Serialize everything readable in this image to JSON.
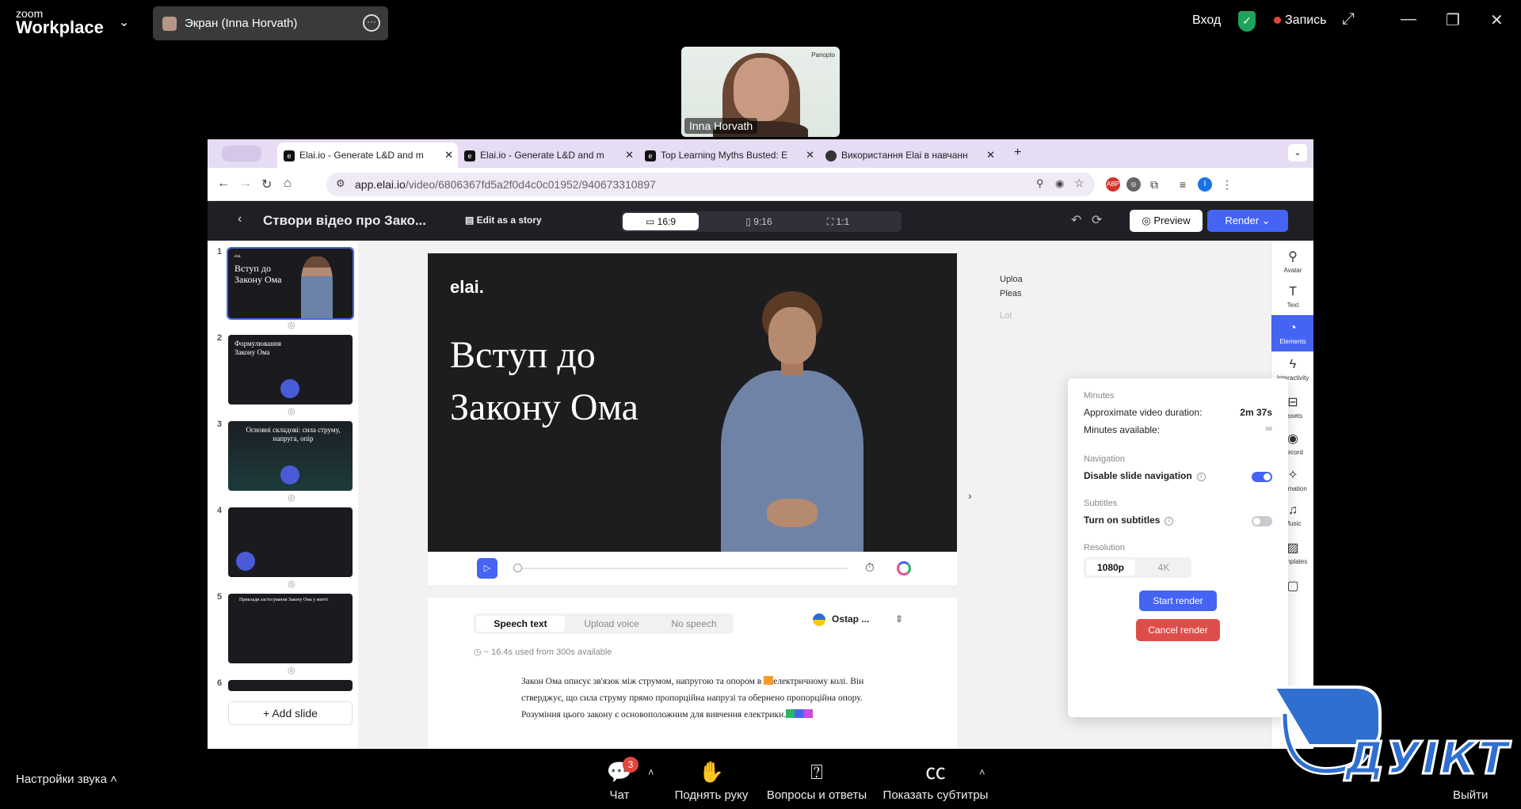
{
  "zoom": {
    "brand_small": "zoom",
    "brand_big": "Workplace",
    "share_label": "Экран (Inna Horvath)",
    "signin": "Вход",
    "record": "Запись",
    "participant_name": "Inna Horvath",
    "participant_brand": "Panopto",
    "bottom": {
      "audio_settings": "Настройки звука",
      "chat": "Чат",
      "chat_badge": "3",
      "raise_hand": "Поднять руку",
      "qa": "Вопросы и ответы",
      "captions": "Показать субтитры",
      "leave": "Выйти"
    }
  },
  "browser": {
    "tabs": [
      {
        "title": "Elai.io - Generate L&D and m",
        "active": true
      },
      {
        "title": "Elai.io - Generate L&D and m",
        "active": false
      },
      {
        "title": "Top Learning Myths Busted: E",
        "active": false
      },
      {
        "title": "Використання Elai в навчанн",
        "active": false
      }
    ],
    "url_host": "app.elai.io",
    "url_path": "/video/6806367fd5a2f0d4c0c01952/940673310897",
    "ext_abp": "ABP",
    "profile_initial": "I"
  },
  "elai": {
    "project_title": "Створи відео про Зако...",
    "edit_story": "Edit as a story",
    "ratios": [
      "16:9",
      "9:16",
      "1:1"
    ],
    "preview": "Preview",
    "render": "Render",
    "slides": [
      {
        "num": "1",
        "title": "Вступ до Закону Ома"
      },
      {
        "num": "2",
        "title": "Формулювання Закону Ома"
      },
      {
        "num": "3",
        "title": "Основні складові: сила струму, напруга, опір"
      },
      {
        "num": "4",
        "title": ""
      },
      {
        "num": "5",
        "title": "Приклади застосування Закону Ома у житті"
      },
      {
        "num": "6",
        "title": ""
      }
    ],
    "add_slide": "Add slide",
    "canvas": {
      "logo": "elai.",
      "title": "Вступ до Закону Ома"
    },
    "speech": {
      "tabs": [
        "Speech text",
        "Upload voice",
        "No speech"
      ],
      "voice": "Ostap ...",
      "used": "~ 16.4s used from 300s available",
      "text_1": "Закон Ома описує зв'язок між струмом, напругою та опором в ",
      "text_2": "електричному колі. Він стверджує, що сила струму прямо пропорційна напрузі та обернено пропорційна опору. Розуміння цього закону є основоположним для вивчення електрики."
    },
    "side_text": [
      "Uploa",
      "Pleas",
      "Lot"
    ],
    "tools": [
      "Avatar",
      "Text",
      "Elements",
      "Interactivity",
      "Assets",
      "Record",
      "Animation",
      "Music",
      "Templates"
    ],
    "render_popup": {
      "minutes_label": "Minutes",
      "duration_label": "Approximate video duration:",
      "duration_value": "2m 37s",
      "available_label": "Minutes available:",
      "available_value": "∞",
      "nav_label": "Navigation",
      "nav_toggle": "Disable slide navigation",
      "nav_on": true,
      "subs_label": "Subtitles",
      "subs_toggle": "Turn on subtitles",
      "subs_on": false,
      "res_label": "Resolution",
      "res_options": [
        "1080p",
        "4K"
      ],
      "res_selected": "1080p",
      "start": "Start render",
      "cancel": "Cancel render"
    }
  },
  "watermark": "ДУІКТ",
  "colors": {
    "accent": "#4564f3",
    "danger": "#dd4e4b",
    "tabbar": "#e6dcf4",
    "app_header": "#1f2026"
  }
}
